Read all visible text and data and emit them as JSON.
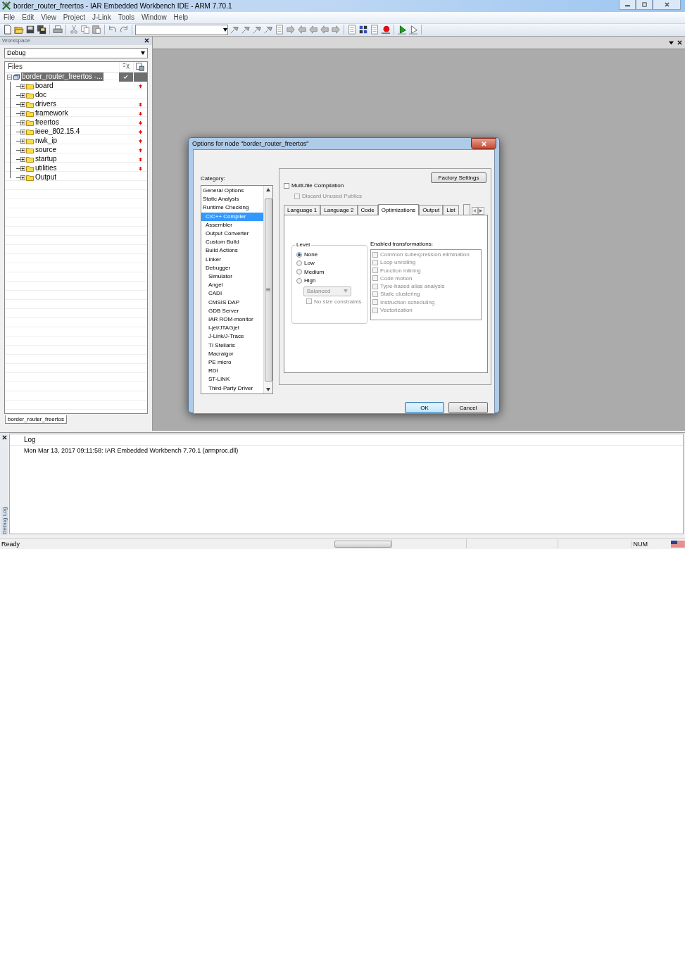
{
  "window": {
    "title": "border_router_freertos - IAR Embedded Workbench IDE - ARM 7.70.1"
  },
  "menu": [
    "File",
    "Edit",
    "View",
    "Project",
    "J-Link",
    "Tools",
    "Window",
    "Help"
  ],
  "workspace": {
    "title": "Workspace",
    "configuration": "Debug",
    "files_header": "Files",
    "tree": {
      "name": "border_router_freertos -...",
      "expanded": true,
      "selected": true,
      "checked": true,
      "children": [
        {
          "name": "board",
          "expanded": false,
          "modified": true
        },
        {
          "name": "doc",
          "expanded": false,
          "modified": false
        },
        {
          "name": "drivers",
          "expanded": false,
          "modified": true
        },
        {
          "name": "framework",
          "expanded": false,
          "modified": true
        },
        {
          "name": "freertos",
          "expanded": false,
          "modified": true
        },
        {
          "name": "ieee_802.15.4",
          "expanded": false,
          "modified": true
        },
        {
          "name": "nwk_ip",
          "expanded": false,
          "modified": true
        },
        {
          "name": "source",
          "expanded": false,
          "modified": true
        },
        {
          "name": "startup",
          "expanded": false,
          "modified": true
        },
        {
          "name": "utilities",
          "expanded": false,
          "modified": true
        },
        {
          "name": "Output",
          "expanded": false,
          "modified": false
        }
      ]
    },
    "tab": "border_router_freertos"
  },
  "dialog": {
    "title": "Options for node \"border_router_freertos\"",
    "category_label": "Category:",
    "categories": [
      {
        "name": "General Options",
        "kind": "general",
        "selected": false
      },
      {
        "name": "Static Analysis",
        "kind": "general",
        "selected": false
      },
      {
        "name": "Runtime Checking",
        "kind": "general",
        "selected": false
      },
      {
        "name": "C/C++ Compiler",
        "kind": "tool",
        "selected": true
      },
      {
        "name": "Assembler",
        "kind": "tool",
        "selected": false
      },
      {
        "name": "Output Converter",
        "kind": "tool",
        "selected": false
      },
      {
        "name": "Custom Build",
        "kind": "tool",
        "selected": false
      },
      {
        "name": "Build Actions",
        "kind": "tool",
        "selected": false
      },
      {
        "name": "Linker",
        "kind": "tool",
        "selected": false
      },
      {
        "name": "Debugger",
        "kind": "tool",
        "selected": false,
        "children": [
          {
            "name": "Simulator",
            "selected": false
          },
          {
            "name": "Angel",
            "selected": false
          },
          {
            "name": "CADI",
            "selected": false
          },
          {
            "name": "CMSIS DAP",
            "selected": false
          },
          {
            "name": "GDB Server",
            "selected": false
          },
          {
            "name": "IAR ROM-monitor",
            "selected": false
          },
          {
            "name": "I-jet/JTAGjet",
            "selected": false
          },
          {
            "name": "J-Link/J-Trace",
            "selected": false
          },
          {
            "name": "TI Stellaris",
            "selected": false
          },
          {
            "name": "Macraigor",
            "selected": false
          },
          {
            "name": "PE micro",
            "selected": false
          },
          {
            "name": "RDI",
            "selected": false
          },
          {
            "name": "ST-LINK",
            "selected": false
          },
          {
            "name": "Third-Party Driver",
            "selected": false
          }
        ]
      }
    ],
    "factory_button": "Factory Settings",
    "multifile": {
      "label": "Multi-file Compilation",
      "checked": false,
      "disabled": false
    },
    "discard": {
      "label": "Discard Unused Publics",
      "checked": false,
      "disabled": true
    },
    "tabs": [
      {
        "label": "Language 1",
        "selected": false
      },
      {
        "label": "Language 2",
        "selected": false
      },
      {
        "label": "Code",
        "selected": false
      },
      {
        "label": "Optimizations",
        "selected": true
      },
      {
        "label": "Output",
        "selected": false
      },
      {
        "label": "List",
        "selected": false
      }
    ],
    "level": {
      "label": "Level",
      "options": [
        {
          "label": "None",
          "selected": true
        },
        {
          "label": "Low",
          "selected": false
        },
        {
          "label": "Medium",
          "selected": false
        },
        {
          "label": "High",
          "selected": false
        }
      ],
      "dropdown": {
        "value": "Balanced",
        "disabled": true
      },
      "no_size": {
        "label": "No size constraints",
        "checked": false,
        "disabled": true
      }
    },
    "transformations": {
      "label": "Enabled transformations:",
      "items": [
        {
          "label": "Common subexpression elimination",
          "checked": false,
          "disabled": true
        },
        {
          "label": "Loop unrolling",
          "checked": false,
          "disabled": true
        },
        {
          "label": "Function inlining",
          "checked": false,
          "disabled": true
        },
        {
          "label": "Code motion",
          "checked": false,
          "disabled": true
        },
        {
          "label": "Type-based alias analysis",
          "checked": false,
          "disabled": true
        },
        {
          "label": "Static clustering",
          "checked": false,
          "disabled": true
        },
        {
          "label": "Instruction scheduling",
          "checked": false,
          "disabled": true
        },
        {
          "label": "Vectorization",
          "checked": false,
          "disabled": true
        }
      ]
    },
    "buttons": [
      {
        "label": "OK",
        "default": true
      },
      {
        "label": "Cancel",
        "default": false
      }
    ]
  },
  "log": {
    "side_tab": "Debug Log",
    "header": "Log",
    "lines": [
      "Mon Mar 13, 2017 09:11:58: IAR Embedded Workbench 7.70.1 (armproc.dll)"
    ]
  },
  "status_bar": {
    "text": "Ready",
    "progress": {
      "level": 0
    },
    "num": "NUM"
  }
}
